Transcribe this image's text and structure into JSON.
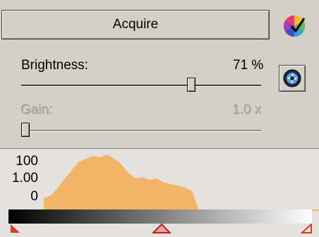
{
  "acquire": {
    "label": "Acquire"
  },
  "brightness": {
    "label": "Brightness:",
    "value_text": "71 %",
    "level": 0.71
  },
  "gain": {
    "label": "Gain:",
    "value_text": "1.0 x",
    "level": 0.0,
    "enabled": false
  },
  "histogram": {
    "axis_labels": [
      "100",
      "1.00",
      "0"
    ],
    "fill_color": "#f2b467"
  },
  "icons": {
    "color_wheel": "color-wheel-icon",
    "lens": "aperture-icon"
  }
}
